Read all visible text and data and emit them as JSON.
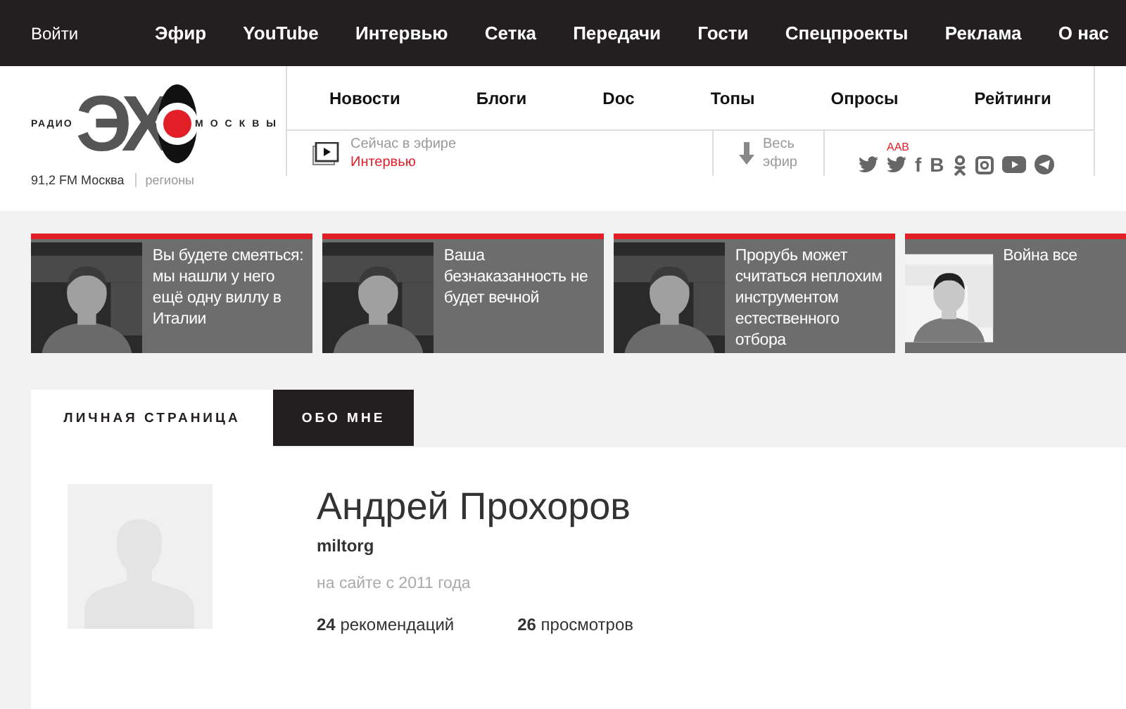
{
  "top_bar": {
    "login": "Войти",
    "menu": [
      "Эфир",
      "YouTube",
      "Интервью",
      "Сетка",
      "Передачи",
      "Гости",
      "Спецпроекты",
      "Реклама",
      "О нас"
    ]
  },
  "logo": {
    "left": "РАДИО",
    "big": "ЭХ",
    "right": "МОСКВЫ"
  },
  "station": {
    "frequency": "91,2 FM Москва",
    "regions": "регионы"
  },
  "nav": [
    "Новости",
    "Блоги",
    "Doc",
    "Топы",
    "Опросы",
    "Рейтинги"
  ],
  "on_air": {
    "label": "Сейчас в эфире",
    "program": "Интервью"
  },
  "archive": {
    "label": "Весь эфир"
  },
  "social": [
    {
      "kind": "bird"
    },
    {
      "kind": "bird",
      "badge": "AAB"
    },
    {
      "kind": "glyph",
      "glyph": "f"
    },
    {
      "kind": "glyph",
      "glyph": "B"
    },
    {
      "kind": "figure"
    },
    {
      "kind": "camera"
    },
    {
      "kind": "play"
    },
    {
      "kind": "plane"
    }
  ],
  "cards": [
    {
      "text": "Вы будете смеяться: мы нашли у него ещё одну виллу в Италии"
    },
    {
      "text": "Ваша безнаказанность не будет вечной"
    },
    {
      "text": "Прорубь может считаться неплохим инструментом естественного отбора"
    },
    {
      "text": "Война все"
    }
  ],
  "tabs": [
    {
      "label": "ЛИЧНАЯ СТРАНИЦА",
      "selected": true
    },
    {
      "label": "ОБО МНЕ",
      "selected": false
    }
  ],
  "profile": {
    "name": "Андрей Прохоров",
    "login": "miltorg",
    "since": "на сайте с 2011 года",
    "stats": [
      {
        "count": "24",
        "label": "рекомендаций"
      },
      {
        "count": "26",
        "label": "просмотров"
      }
    ]
  }
}
